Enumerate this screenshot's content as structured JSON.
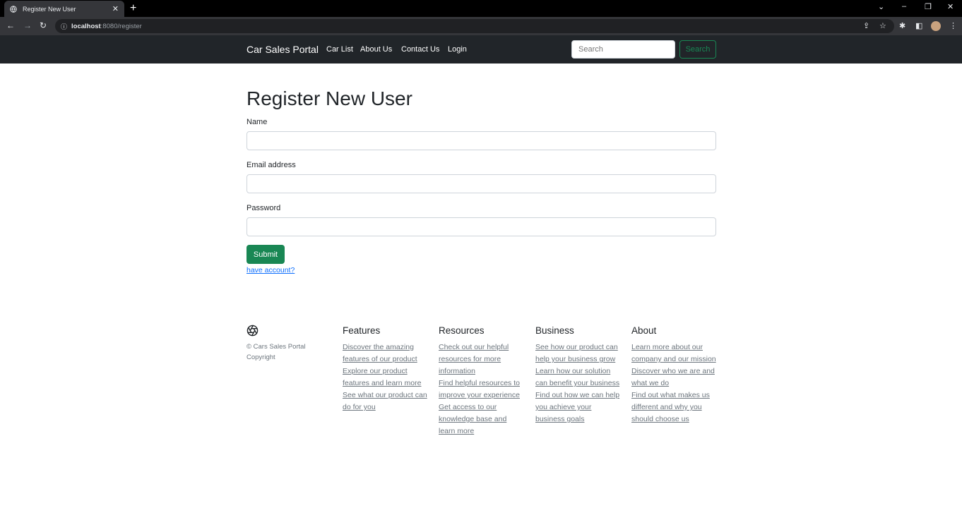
{
  "browser": {
    "tab_title": "Register New User",
    "tab_close": "✕",
    "new_tab": "+",
    "url_host": "localhost",
    "url_path": ":8080/register",
    "controls": {
      "minimize": "–",
      "restore": "❐",
      "close": "✕",
      "collapse": "⌄"
    }
  },
  "navbar": {
    "brand": "Car Sales Portal",
    "links": [
      "Car List",
      "About Us",
      "Contact Us",
      "Login"
    ],
    "search_placeholder": "Search",
    "search_button": "Search"
  },
  "form": {
    "title": "Register New User",
    "name_label": "Name",
    "email_label": "Email address",
    "password_label": "Password",
    "submit_label": "Submit",
    "have_account": "have account?"
  },
  "footer": {
    "copyright": "© Cars Sales Portal Copyright",
    "columns": [
      {
        "heading": "Features",
        "links": [
          "Discover the amazing features of our product",
          "Explore our product features and learn more",
          "See what our product can do for you"
        ]
      },
      {
        "heading": "Resources",
        "links": [
          "Check out our helpful resources for more information",
          "Find helpful resources to improve your experience",
          "Get access to our knowledge base and learn more"
        ]
      },
      {
        "heading": "Business",
        "links": [
          "See how our product can help your business grow",
          "Learn how our solution can benefit your business",
          "Find out how we can help you achieve your business goals"
        ]
      },
      {
        "heading": "About",
        "links": [
          "Learn more about our company and our mission",
          "Discover who we are and what we do",
          "Find out what makes us different and why you should choose us"
        ]
      }
    ]
  },
  "colors": {
    "navbar_bg": "#212529",
    "accent_green": "#198754",
    "link_blue": "#0d6efd"
  }
}
